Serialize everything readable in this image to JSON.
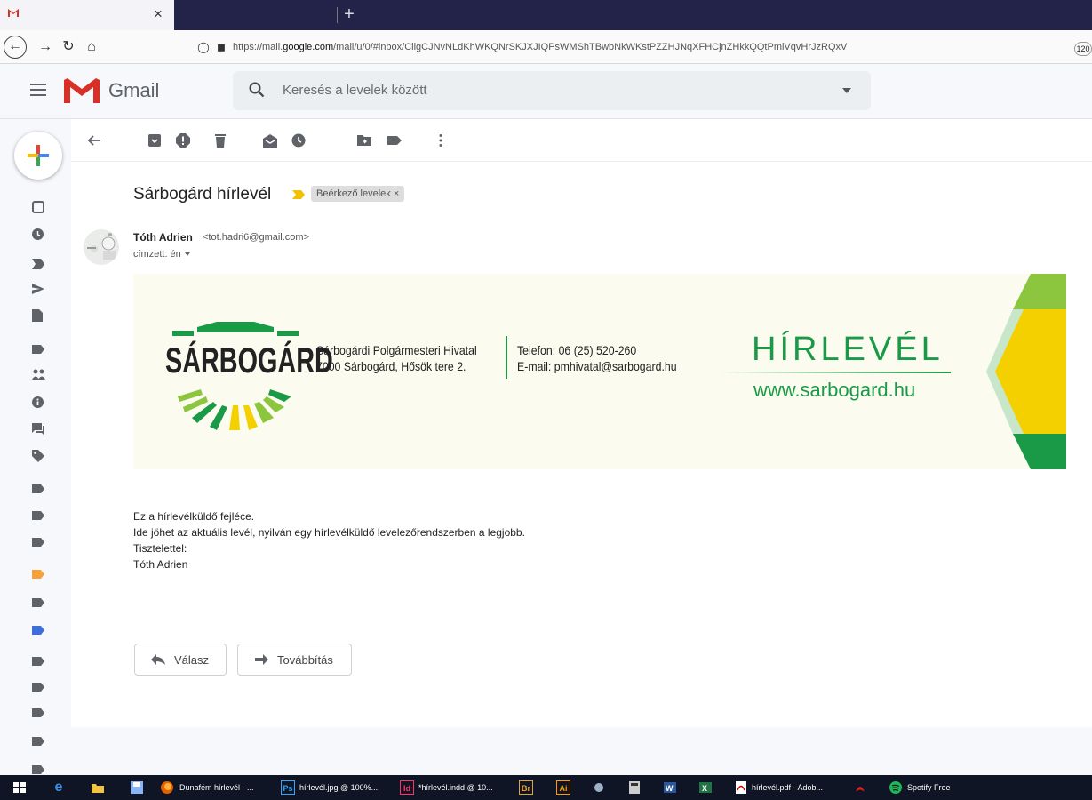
{
  "browser": {
    "tab_close": "×",
    "new_tab": "+",
    "url_prefix": "https://mail.",
    "url_host": "google.com",
    "url_path": "/mail/u/0/#inbox/CllgCJNvNLdKhWKQNrSKJXJIQPsWMShTBwbNkWKstPZZHJNqXFHCjnZHkkQQtPmlVqvHrJzRQxV",
    "zoom": "120"
  },
  "gmail": {
    "app_title": "Gmail",
    "search_placeholder": "Keresés a levelek között"
  },
  "message": {
    "subject": "Sárbogárd hírlevél",
    "label": "Beérkező levelek ×",
    "sender_name": "Tóth Adrien",
    "sender_email": "<tot.hadri6@gmail.com>",
    "recipient": "címzett: én",
    "body": [
      "Ez a hírlevélküldő fejléce.",
      "Ide jöhet az aktuális levél, nyilván egy hírlevélküldő levelezőrendszerben a legjobb.",
      "Tisztelettel:",
      "Tóth Adrien"
    ],
    "reply_label": "Válasz",
    "forward_label": "Továbbítás"
  },
  "banner": {
    "logo_text": "SÁRBOGÁRD",
    "office_name": "Sárbogárdi Polgármesteri Hivatal",
    "office_address": "7000 Sárbogárd, Hősök tere 2.",
    "phone": "Telefon: 06 (25) 520-260",
    "email": "E-mail: pmhivatal@sarbogard.hu",
    "newsletter_title": "HÍRLEVÉL",
    "website": "www.sarbogard.hu"
  },
  "taskbar": {
    "items": [
      "Dunafém hírlevél - ...",
      "hírlevél.jpg @ 100%...",
      "*hírlevél.indd @ 10...",
      "hírlevél.pdf - Adob...",
      "Spotify Free"
    ],
    "ps": "Ps",
    "id": "Id",
    "br": "Br",
    "ai": "Ai"
  },
  "colors": {
    "gmail_red": "#d93025",
    "brand_green": "#1a9a47",
    "brand_yellow": "#f5d000",
    "light_green": "#8cc63f"
  }
}
